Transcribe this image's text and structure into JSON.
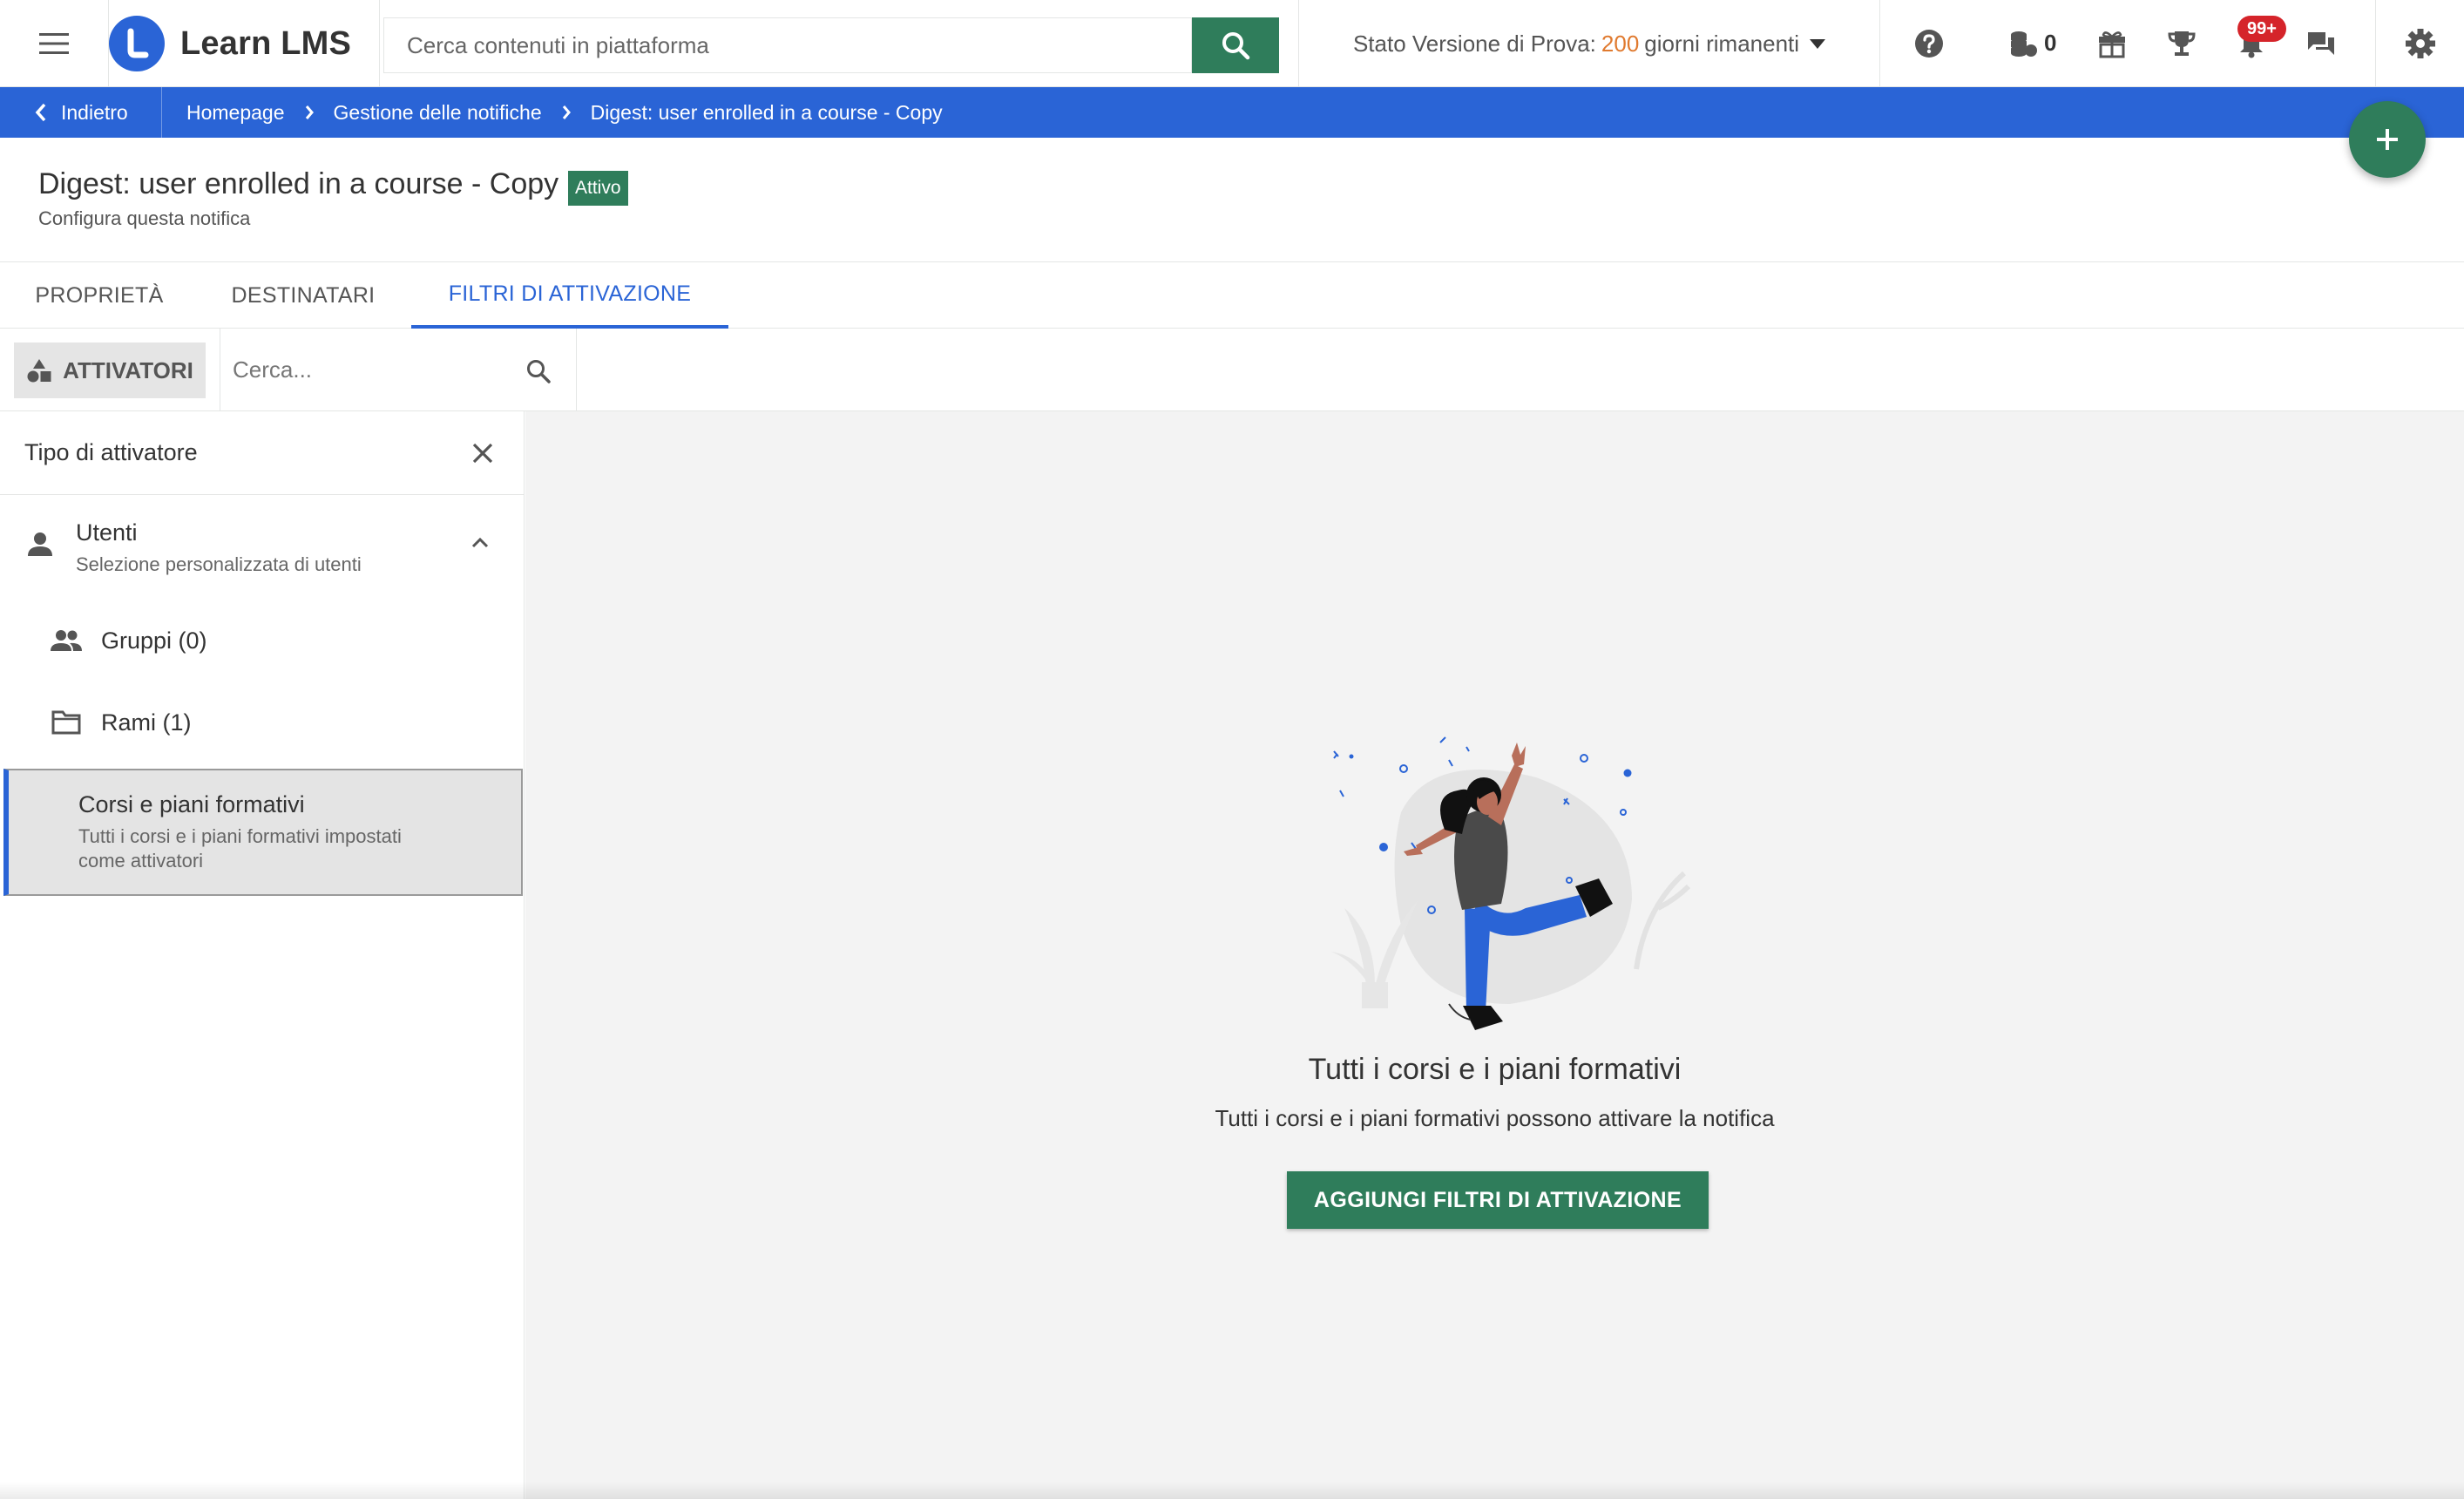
{
  "header": {
    "app_name": "Learn LMS",
    "search_placeholder": "Cerca contenuti in piattaforma",
    "trial_prefix": "Stato Versione di Prova:",
    "trial_days": "200",
    "trial_suffix": "giorni rimanenti",
    "credits_count": "0",
    "notifications_badge": "99+"
  },
  "breadcrumb": {
    "back_label": "Indietro",
    "items": [
      "Homepage",
      "Gestione delle notifiche",
      "Digest: user enrolled in a course - Copy"
    ]
  },
  "page": {
    "title": "Digest: user enrolled in a course - Copy",
    "status": "Attivo",
    "subtitle": "Configura questa notifica"
  },
  "tabs": [
    {
      "label": "PROPRIETÀ",
      "active": false
    },
    {
      "label": "DESTINATARI",
      "active": false
    },
    {
      "label": "FILTRI DI ATTIVAZIONE",
      "active": true
    }
  ],
  "toolbar": {
    "activators_label": "ATTIVATORI",
    "search_placeholder": "Cerca..."
  },
  "left_panel": {
    "title": "Tipo di attivatore",
    "users": {
      "label": "Utenti",
      "sub": "Selezione personalizzata di utenti"
    },
    "groups": {
      "label": "Gruppi (0)"
    },
    "branches": {
      "label": "Rami (1)"
    },
    "courses": {
      "label": "Corsi e piani formativi",
      "sub_line1": "Tutti i corsi e i piani formativi impostati",
      "sub_line2": "come attivatori"
    }
  },
  "empty_state": {
    "title": "Tutti i corsi e i piani formativi",
    "subtitle": "Tutti i corsi e i piani formativi possono attivare la notifica",
    "button_label": "AGGIUNGI FILTRI DI ATTIVAZIONE"
  },
  "colors": {
    "primary_blue": "#2a64d6",
    "primary_green": "#2f7d5b",
    "trial_orange": "#e07a2f",
    "badge_red": "#d5242a"
  },
  "icons": [
    "menu-icon",
    "search-icon",
    "help-icon",
    "coins-icon",
    "gift-icon",
    "trophy-icon",
    "bell-icon",
    "chat-icon",
    "gear-icon",
    "chevron-left-icon",
    "chevron-right-icon",
    "plus-icon",
    "shapes-icon",
    "close-icon",
    "person-icon",
    "people-icon",
    "folder-icon",
    "chevron-up-icon"
  ]
}
